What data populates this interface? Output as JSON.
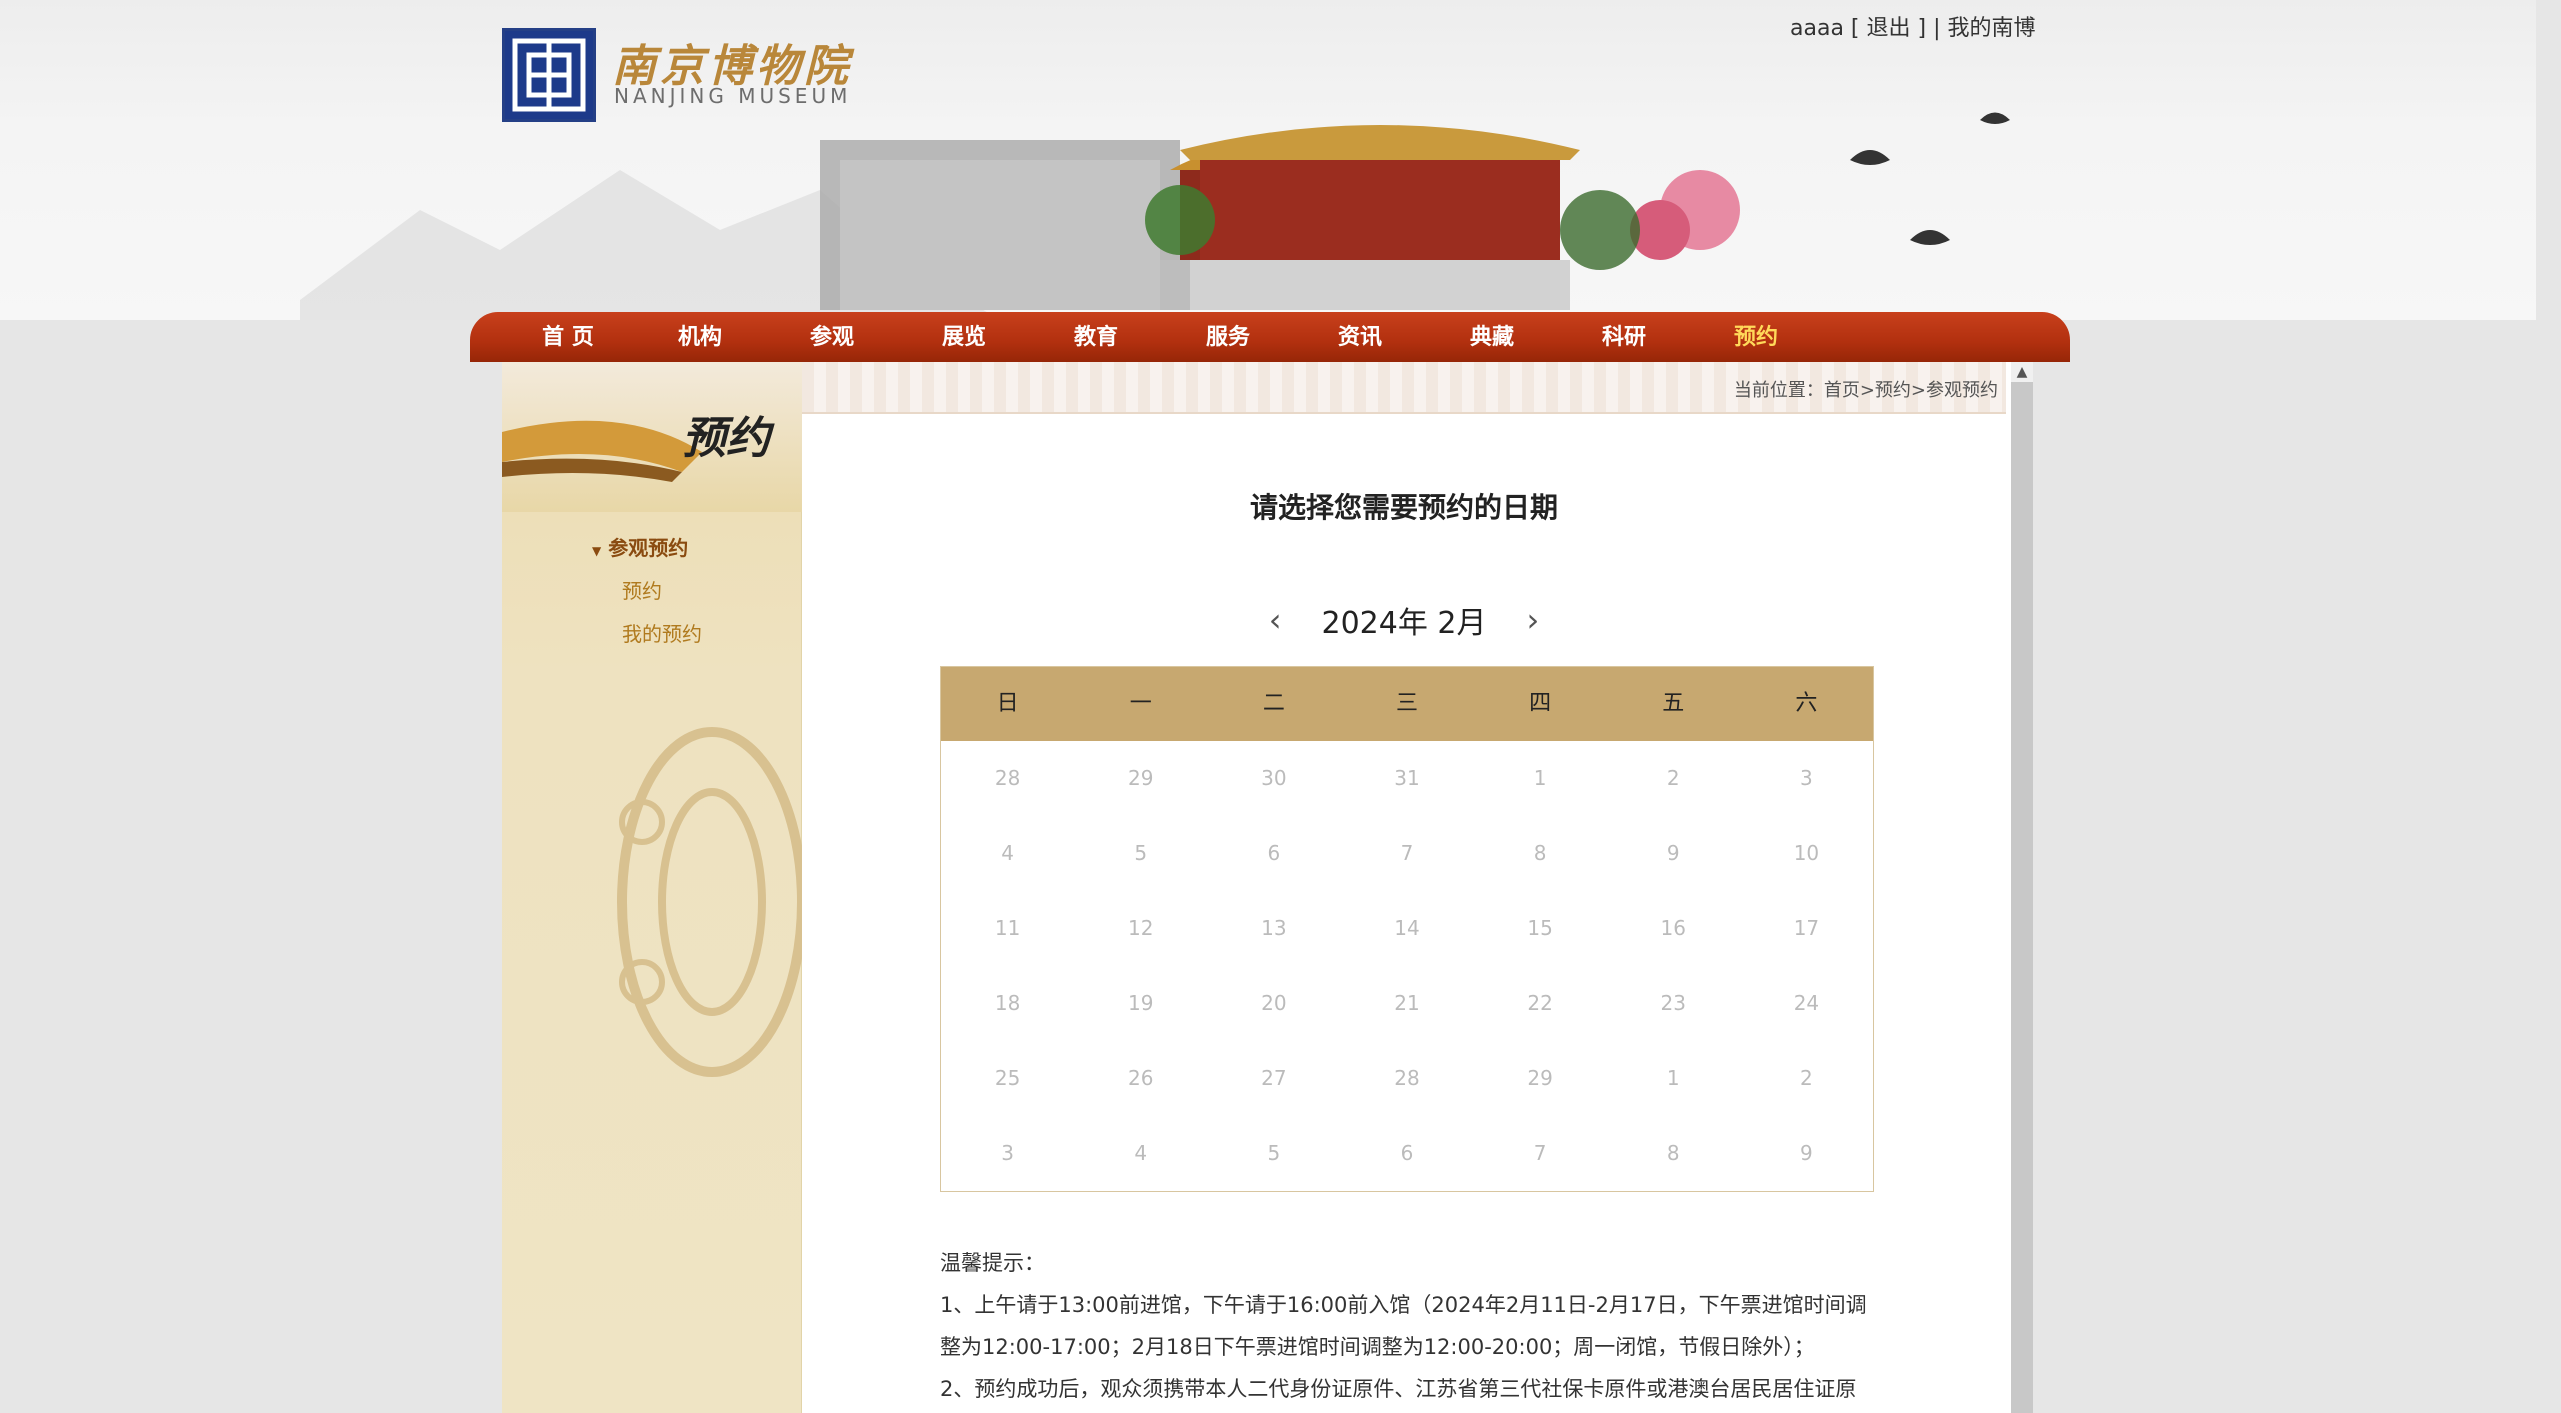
{
  "top_links": {
    "user": "aaaa",
    "open_bracket": " [ ",
    "logout": "退出",
    "close_bracket": " ] | ",
    "my_museum": "我的南博"
  },
  "logo": {
    "cn": "南京博物院",
    "en": "NANJING MUSEUM"
  },
  "nav": {
    "items": [
      "首 页",
      "机构",
      "参观",
      "展览",
      "教育",
      "服务",
      "资讯",
      "典藏",
      "科研",
      "预约"
    ],
    "active_index": 9
  },
  "sidebar": {
    "title": "预约",
    "group": "参观预约",
    "items": [
      "预约",
      "我的预约"
    ]
  },
  "breadcrumb": "当前位置：首页>预约>参观预约",
  "heading": "请选择您需要预约的日期",
  "month_nav": {
    "prev": "‹",
    "label": "2024年  2月",
    "next": "›"
  },
  "calendar": {
    "weekdays": [
      "日",
      "一",
      "二",
      "三",
      "四",
      "五",
      "六"
    ],
    "weeks": [
      [
        "28",
        "29",
        "30",
        "31",
        "1",
        "2",
        "3"
      ],
      [
        "4",
        "5",
        "6",
        "7",
        "8",
        "9",
        "10"
      ],
      [
        "11",
        "12",
        "13",
        "14",
        "15",
        "16",
        "17"
      ],
      [
        "18",
        "19",
        "20",
        "21",
        "22",
        "23",
        "24"
      ],
      [
        "25",
        "26",
        "27",
        "28",
        "29",
        "1",
        "2"
      ],
      [
        "3",
        "4",
        "5",
        "6",
        "7",
        "8",
        "9"
      ]
    ]
  },
  "notice": {
    "title": "温馨提示：",
    "line1": "1、上午请于13:00前进馆，下午请于16:00前入馆（2024年2月11日-2月17日，下午票进馆时间调整为12:00-17:00；2月18日下午票进馆时间调整为12:00-20:00；周一闭馆，节假日除外）；",
    "line2": "2、预约成功后，观众须携带本人二代身份证原件、江苏省第三代社保卡原件或港澳台居民居住证原"
  },
  "colors": {
    "nav_red": "#b2300f",
    "calendar_header": "#c7a870",
    "sidebar_beige": "#eee2c0"
  }
}
